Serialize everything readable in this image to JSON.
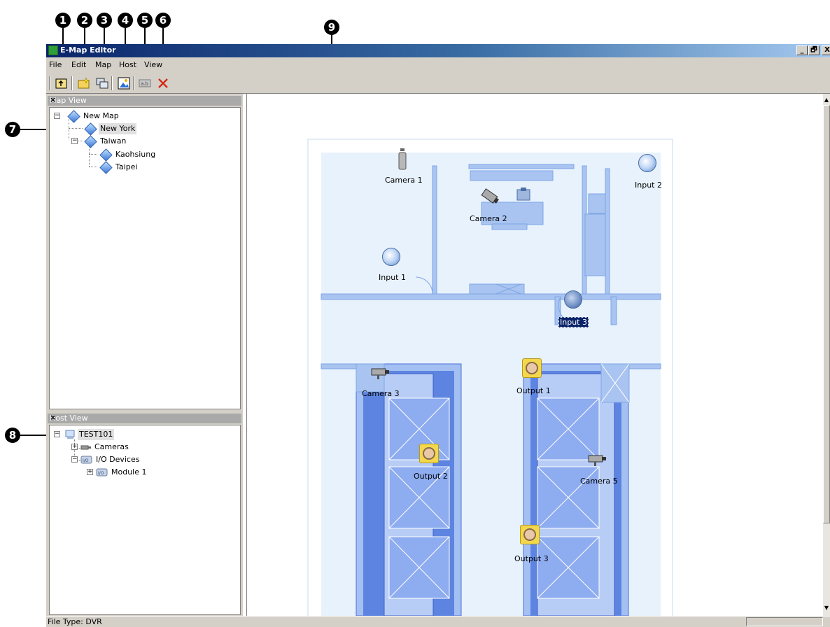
{
  "callouts": [
    "1",
    "2",
    "3",
    "4",
    "5",
    "6",
    "7",
    "8",
    "9"
  ],
  "window": {
    "title": "E-Map Editor",
    "buttons": {
      "minimize": "_",
      "restore": "🗗",
      "close": "X"
    }
  },
  "menu": {
    "items": [
      "File",
      "Edit",
      "Map",
      "Host",
      "View"
    ]
  },
  "map_view": {
    "title": "Map View",
    "close": "×",
    "tree": [
      {
        "label": "New Map"
      },
      {
        "label": "New York"
      },
      {
        "label": "Taiwan"
      },
      {
        "label": "Kaohsiung"
      },
      {
        "label": "Taipei"
      }
    ]
  },
  "host_view": {
    "title": "Host View",
    "close": "×",
    "tree": [
      {
        "label": "TEST101"
      },
      {
        "label": "Cameras"
      },
      {
        "label": "I/O Devices"
      },
      {
        "label": "Module 1"
      }
    ]
  },
  "map": {
    "devices": {
      "camera1": "Camera 1",
      "camera2": "Camera 2",
      "camera3": "Camera 3",
      "camera5": "Camera 5",
      "input1": "Input 1",
      "input2": "Input 2",
      "input3": "Input 3",
      "output1": "Output 1",
      "output2": "Output 2",
      "output3": "Output 3"
    },
    "colors": {
      "floor": "#e8f2fd",
      "wall": "#7da6e6",
      "escalator": "#4b6fd8"
    }
  },
  "status": {
    "text": "File Type: DVR"
  }
}
